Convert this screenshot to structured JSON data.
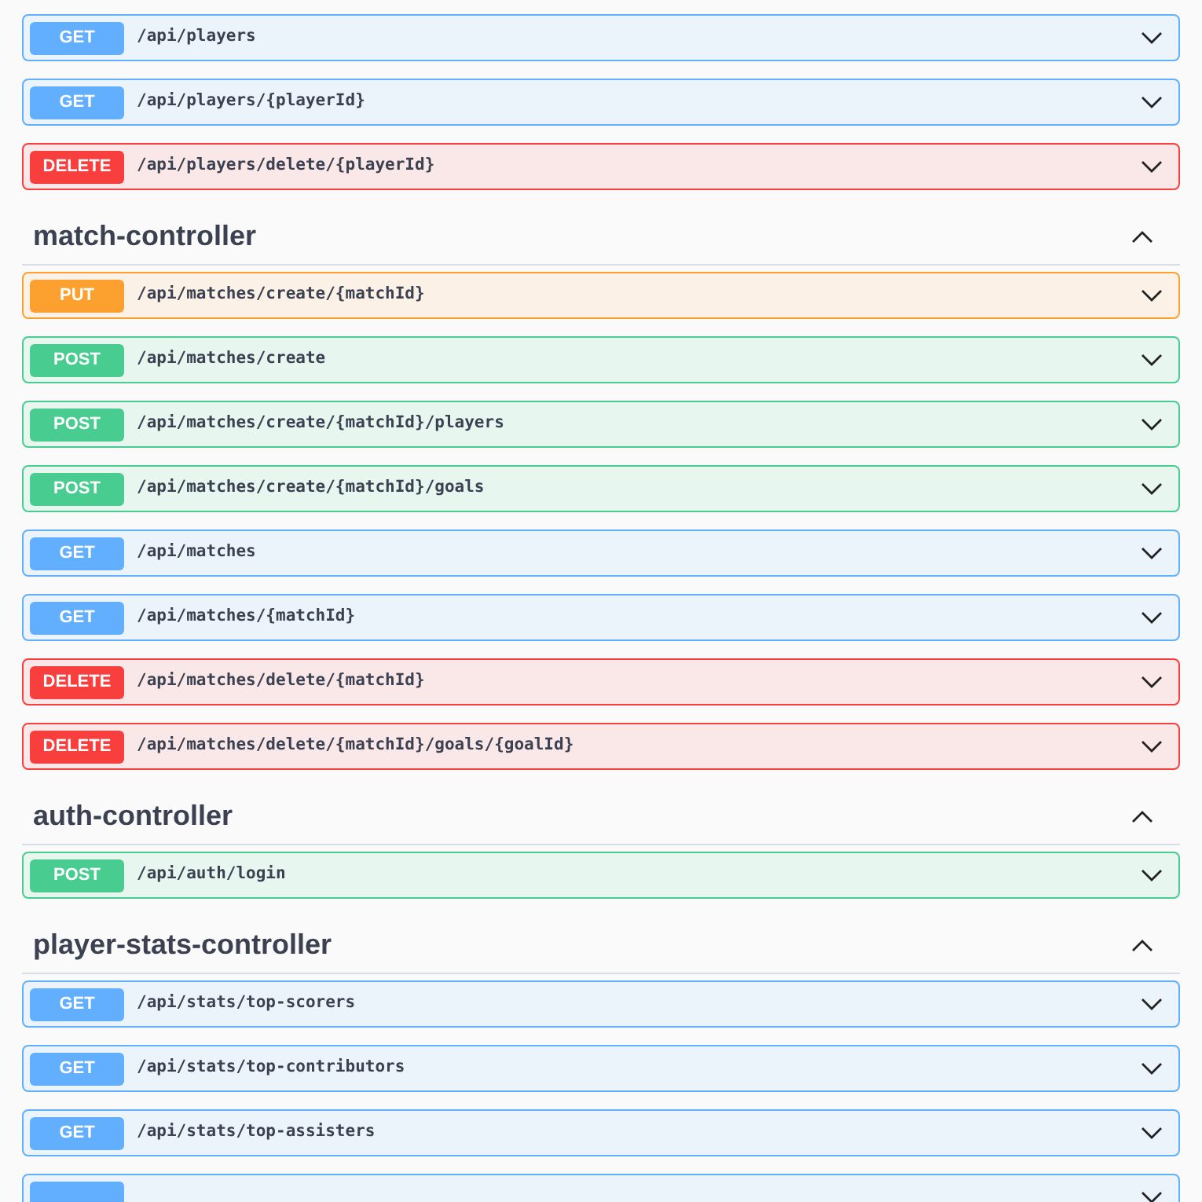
{
  "sections": [
    {
      "operations": [
        {
          "kind": "get",
          "method": "GET",
          "path": "/api/players"
        },
        {
          "kind": "get",
          "method": "GET",
          "path": "/api/players/{playerId}"
        },
        {
          "kind": "delete",
          "method": "DELETE",
          "path": "/api/players/delete/{playerId}"
        }
      ]
    },
    {
      "title": "match-controller",
      "expanded": true,
      "operations": [
        {
          "kind": "put",
          "method": "PUT",
          "path": "/api/matches/create/{matchId}"
        },
        {
          "kind": "post",
          "method": "POST",
          "path": "/api/matches/create"
        },
        {
          "kind": "post",
          "method": "POST",
          "path": "/api/matches/create/{matchId}/players"
        },
        {
          "kind": "post",
          "method": "POST",
          "path": "/api/matches/create/{matchId}/goals"
        },
        {
          "kind": "get",
          "method": "GET",
          "path": "/api/matches"
        },
        {
          "kind": "get",
          "method": "GET",
          "path": "/api/matches/{matchId}"
        },
        {
          "kind": "delete",
          "method": "DELETE",
          "path": "/api/matches/delete/{matchId}"
        },
        {
          "kind": "delete",
          "method": "DELETE",
          "path": "/api/matches/delete/{matchId}/goals/{goalId}"
        }
      ]
    },
    {
      "title": "auth-controller",
      "expanded": true,
      "operations": [
        {
          "kind": "post",
          "method": "POST",
          "path": "/api/auth/login"
        }
      ]
    },
    {
      "title": "player-stats-controller",
      "expanded": true,
      "operations": [
        {
          "kind": "get",
          "method": "GET",
          "path": "/api/stats/top-scorers"
        },
        {
          "kind": "get",
          "method": "GET",
          "path": "/api/stats/top-contributors"
        },
        {
          "kind": "get",
          "method": "GET",
          "path": "/api/stats/top-assisters"
        },
        {
          "kind": "get"
        }
      ]
    }
  ]
}
